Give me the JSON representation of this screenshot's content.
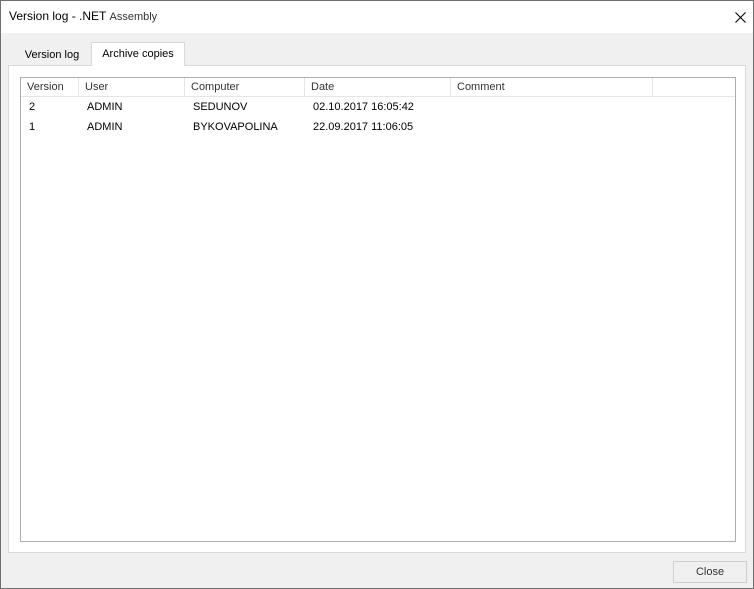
{
  "window": {
    "title_main": "Version log - .NET",
    "title_sub": "Assembly"
  },
  "tabs": [
    {
      "label": "Version log",
      "active": false
    },
    {
      "label": "Archive copies",
      "active": true
    }
  ],
  "table": {
    "columns": [
      "Version",
      "User",
      "Computer",
      "Date",
      "Comment"
    ],
    "rows": [
      {
        "version": "2",
        "user": "ADMIN",
        "computer": "SEDUNOV",
        "date": "02.10.2017 16:05:42",
        "comment": ""
      },
      {
        "version": "1",
        "user": "ADMIN",
        "computer": "BYKOVAPOLINA",
        "date": "22.09.2017 11:06:05",
        "comment": ""
      }
    ]
  },
  "footer": {
    "close_label": "Close"
  }
}
